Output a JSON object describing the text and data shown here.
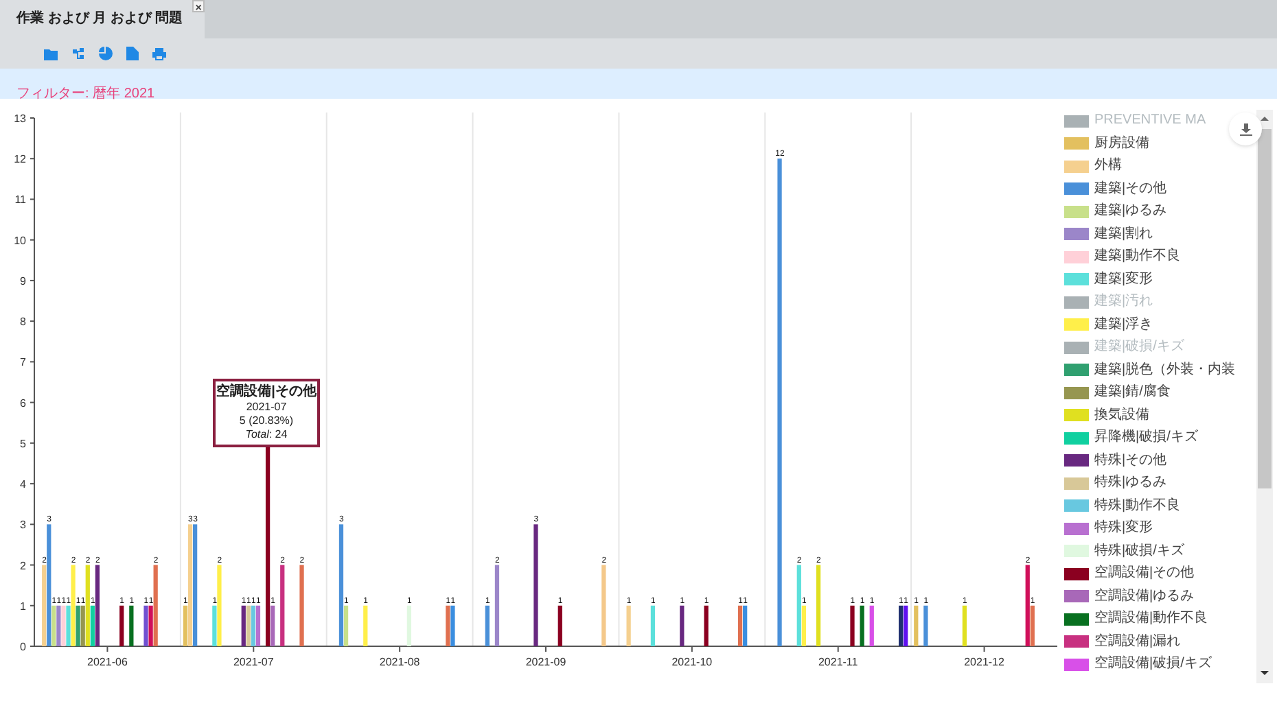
{
  "tab": {
    "title": "作業 および 月 および 問題",
    "close": "×",
    "selected": true
  },
  "filter": {
    "text": "フィルター: 暦年 2021"
  },
  "chart": {
    "chart_data": {
      "type": "bar",
      "categories": [
        "2021-06",
        "2021-07",
        "2021-08",
        "2021-09",
        "2021-10",
        "2021-11",
        "2021-12"
      ],
      "ylim": [
        0,
        13
      ],
      "yticks": [
        0,
        1,
        2,
        3,
        4,
        5,
        6,
        7,
        8,
        9,
        10,
        11,
        12,
        13
      ],
      "series": [
        {
          "color": "#e3c05f",
          "values": [
            0,
            1,
            0,
            0,
            0,
            0,
            1
          ],
          "value_labels": [
            null,
            "1",
            null,
            null,
            null,
            null,
            "1"
          ]
        },
        {
          "color": "#f5d08f",
          "values": [
            2,
            3,
            0,
            0,
            1,
            0,
            0
          ],
          "value_labels": [
            "2",
            "3",
            null,
            null,
            "1",
            null,
            null
          ]
        },
        {
          "color": "#4a90d9",
          "values": [
            3,
            3,
            3,
            1,
            0,
            12,
            1
          ],
          "value_labels": [
            "3",
            "3",
            "3",
            "1",
            null,
            "12",
            "1"
          ]
        },
        {
          "color": "#c8e08a",
          "values": [
            1,
            0,
            1,
            0,
            0,
            0,
            0
          ],
          "value_labels": [
            "1",
            null,
            "1",
            null,
            null,
            null,
            null
          ]
        },
        {
          "color": "#9b86c9",
          "values": [
            1,
            0,
            0,
            2,
            0,
            0,
            0
          ],
          "value_labels": [
            "1",
            null,
            null,
            "2",
            null,
            null,
            null
          ]
        },
        {
          "color": "#ffd0d8",
          "values": [
            1,
            0,
            0,
            0,
            0,
            0,
            0
          ],
          "value_labels": [
            "1",
            null,
            null,
            null,
            null,
            null,
            null
          ]
        },
        {
          "color": "#5ce0db",
          "values": [
            1,
            1,
            0,
            0,
            1,
            2,
            0
          ],
          "value_labels": [
            "1",
            "1",
            null,
            null,
            "1",
            "2",
            null
          ]
        },
        {
          "color": "#ffef4a",
          "values": [
            2,
            2,
            1,
            0,
            0,
            1,
            0
          ],
          "value_labels": [
            "2",
            "2",
            "1",
            null,
            null,
            "1",
            null
          ]
        },
        {
          "color": "#30a070",
          "values": [
            1,
            0,
            0,
            0,
            0,
            0,
            0
          ],
          "value_labels": [
            "1",
            null,
            null,
            null,
            null,
            null,
            null
          ]
        },
        {
          "color": "#969650",
          "values": [
            1,
            0,
            0,
            0,
            0,
            0,
            0
          ],
          "value_labels": [
            "1",
            null,
            null,
            null,
            null,
            null,
            null
          ]
        },
        {
          "color": "#e0e020",
          "values": [
            2,
            0,
            0,
            0,
            0,
            2,
            1
          ],
          "value_labels": [
            "2",
            null,
            null,
            null,
            null,
            "2",
            "1"
          ]
        },
        {
          "color": "#10d0a0",
          "values": [
            1,
            0,
            0,
            0,
            0,
            0,
            0
          ],
          "value_labels": [
            "1",
            null,
            null,
            null,
            null,
            null,
            null
          ]
        },
        {
          "color": "#682880",
          "values": [
            2,
            1,
            0,
            3,
            1,
            0,
            0
          ],
          "value_labels": [
            "2",
            "1",
            null,
            "3",
            "1",
            null,
            null
          ]
        },
        {
          "color": "#d8c898",
          "values": [
            0,
            1,
            0,
            0,
            0,
            0,
            0
          ],
          "value_labels": [
            null,
            "1",
            null,
            null,
            null,
            null,
            null
          ]
        },
        {
          "color": "#68c8e0",
          "values": [
            0,
            1,
            0,
            0,
            0,
            0,
            0
          ],
          "value_labels": [
            null,
            "1",
            null,
            null,
            null,
            null,
            null
          ]
        },
        {
          "color": "#b870d0",
          "values": [
            0,
            1,
            0,
            0,
            0,
            0,
            0
          ],
          "value_labels": [
            null,
            "1",
            null,
            null,
            null,
            null,
            null
          ]
        },
        {
          "color": "#e0f8e0",
          "values": [
            0,
            0,
            1,
            0,
            0,
            0,
            0
          ],
          "value_labels": [
            null,
            null,
            "1",
            null,
            null,
            null,
            null
          ]
        },
        {
          "color": "#8b0020",
          "values": [
            1,
            5,
            0,
            1,
            1,
            1,
            0
          ],
          "value_labels": [
            "1",
            null,
            null,
            "1",
            "1",
            "1",
            null
          ]
        },
        {
          "color": "#a868b8",
          "values": [
            0,
            1,
            0,
            0,
            0,
            0,
            0
          ],
          "value_labels": [
            null,
            "1",
            null,
            null,
            null,
            null,
            null
          ]
        },
        {
          "color": "#087020",
          "values": [
            1,
            0,
            0,
            0,
            0,
            1,
            0
          ],
          "value_labels": [
            "1",
            null,
            null,
            null,
            null,
            "1",
            null
          ]
        },
        {
          "color": "#c83080",
          "values": [
            0,
            2,
            0,
            0,
            0,
            0,
            0
          ],
          "value_labels": [
            null,
            "2",
            null,
            null,
            null,
            null,
            null
          ]
        },
        {
          "color": "#d850e8",
          "values": [
            0,
            0,
            0,
            0,
            0,
            1,
            0
          ],
          "value_labels": [
            null,
            null,
            null,
            null,
            null,
            "1",
            null
          ]
        },
        {
          "color": "#7050d0",
          "values": [
            1,
            0,
            0,
            0,
            0,
            0,
            0
          ],
          "value_labels": [
            "1",
            null,
            null,
            null,
            null,
            null,
            null
          ]
        },
        {
          "color": "#d0105a",
          "values": [
            1,
            0,
            0,
            0,
            0,
            0,
            2
          ],
          "value_labels": [
            "1",
            null,
            null,
            null,
            null,
            null,
            "2"
          ]
        },
        {
          "color": "#e07050",
          "values": [
            2,
            2,
            1,
            0,
            1,
            0,
            1
          ],
          "value_labels": [
            "2",
            "2",
            "1",
            null,
            "1",
            null,
            "1"
          ]
        },
        {
          "color": "#3a8ee0",
          "values": [
            0,
            0,
            1,
            0,
            1,
            0,
            0
          ],
          "value_labels": [
            null,
            null,
            "1",
            null,
            "1",
            null,
            null
          ]
        },
        {
          "color": "#f4c88a",
          "values": [
            0,
            0,
            0,
            2,
            0,
            0,
            0
          ],
          "value_labels": [
            null,
            null,
            null,
            "2",
            null,
            null,
            null
          ]
        },
        {
          "color": "#203070",
          "values": [
            0,
            0,
            0,
            0,
            0,
            1,
            0
          ],
          "value_labels": [
            null,
            null,
            null,
            null,
            null,
            "1",
            null
          ]
        },
        {
          "color": "#6010f0",
          "values": [
            0,
            0,
            0,
            0,
            0,
            1,
            0
          ],
          "value_labels": [
            null,
            null,
            null,
            null,
            null,
            "1",
            null
          ]
        }
      ]
    },
    "tooltip": {
      "title": "空調設備|その他",
      "lines": [
        "2021-07",
        "5 (20.83%)",
        "*Total*: 24"
      ]
    },
    "legend": {
      "items": [
        {
          "label": "PREVENTIVE MA",
          "color": "#a9b1b4",
          "enabled": false
        },
        {
          "label": "厨房設備",
          "color": "#e3c05f",
          "enabled": true
        },
        {
          "label": "外構",
          "color": "#f5d08f",
          "enabled": true
        },
        {
          "label": "建築|その他",
          "color": "#4a90d9",
          "enabled": true
        },
        {
          "label": "建築|ゆるみ",
          "color": "#c8e08a",
          "enabled": true
        },
        {
          "label": "建築|割れ",
          "color": "#9b86c9",
          "enabled": true
        },
        {
          "label": "建築|動作不良",
          "color": "#ffd0d8",
          "enabled": true
        },
        {
          "label": "建築|変形",
          "color": "#5ce0db",
          "enabled": true
        },
        {
          "label": "建築|汚れ",
          "color": "#a9b1b4",
          "enabled": false
        },
        {
          "label": "建築|浮き",
          "color": "#ffef4a",
          "enabled": true
        },
        {
          "label": "建築|破損/キズ",
          "color": "#a9b1b4",
          "enabled": false
        },
        {
          "label": "建築|脱色（外装・内装",
          "color": "#30a070",
          "enabled": true
        },
        {
          "label": "建築|錆/腐食",
          "color": "#969650",
          "enabled": true
        },
        {
          "label": "換気設備",
          "color": "#e0e020",
          "enabled": true
        },
        {
          "label": "昇降機|破損/キズ",
          "color": "#10d0a0",
          "enabled": true
        },
        {
          "label": "特殊|その他",
          "color": "#682880",
          "enabled": true
        },
        {
          "label": "特殊|ゆるみ",
          "color": "#d8c898",
          "enabled": true
        },
        {
          "label": "特殊|動作不良",
          "color": "#68c8e0",
          "enabled": true
        },
        {
          "label": "特殊|変形",
          "color": "#b870d0",
          "enabled": true
        },
        {
          "label": "特殊|破損/キズ",
          "color": "#e0f8e0",
          "enabled": true
        },
        {
          "label": "空調設備|その他",
          "color": "#8b0020",
          "enabled": true
        },
        {
          "label": "空調設備|ゆるみ",
          "color": "#a868b8",
          "enabled": true
        },
        {
          "label": "空調設備|動作不良",
          "color": "#087020",
          "enabled": true
        },
        {
          "label": "空調設備|漏れ",
          "color": "#c83080",
          "enabled": true
        },
        {
          "label": "空調設備|破損/キズ",
          "color": "#d850e8",
          "enabled": true
        }
      ]
    }
  }
}
